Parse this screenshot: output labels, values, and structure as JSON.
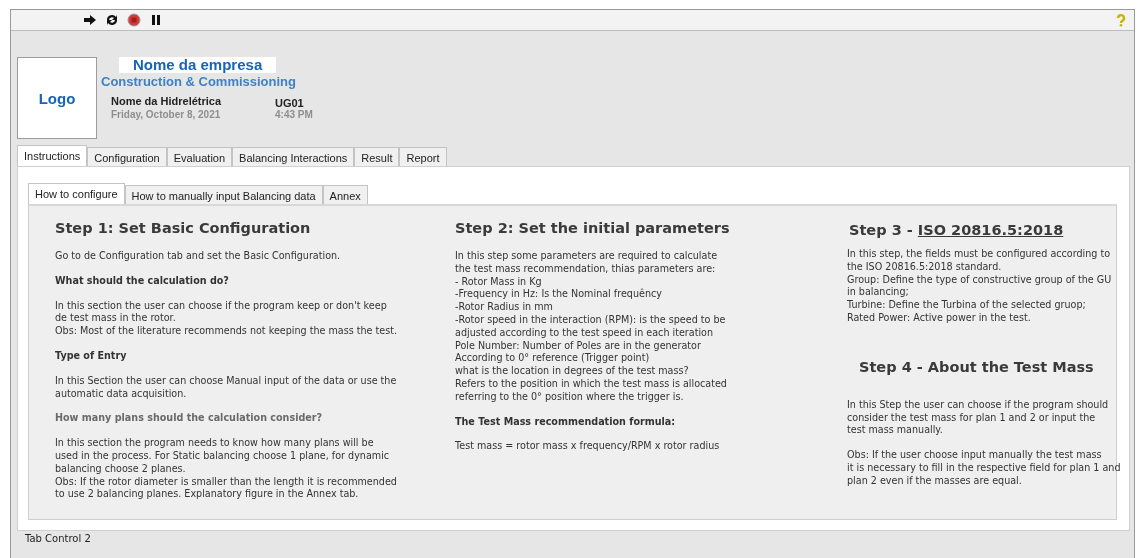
{
  "header": {
    "logo": "Logo",
    "company": "Nome da empresa",
    "subtitle": "Construction & Commissioning",
    "plant": "Nome da Hidrelétrica",
    "unit": "UG01",
    "date": "Friday, October 8, 2021",
    "time": "4:43 PM"
  },
  "tabs": [
    {
      "label": "Instructions",
      "selected": true
    },
    {
      "label": "Configuration",
      "selected": false
    },
    {
      "label": "Evaluation",
      "selected": false
    },
    {
      "label": "Balancing Interactions",
      "selected": false
    },
    {
      "label": "Result",
      "selected": false
    },
    {
      "label": "Report",
      "selected": false
    }
  ],
  "subtabs": [
    {
      "label": "How to configure",
      "selected": true
    },
    {
      "label": "How to manually input Balancing data",
      "selected": false
    },
    {
      "label": "Annex",
      "selected": false
    }
  ],
  "columns": [
    {
      "blocks": [
        {
          "kind": "heading",
          "text": "Step 1: Set Basic Configuration"
        },
        {
          "kind": "text",
          "lines": [
            "Go to de Configuration tab and set the Basic Configuration."
          ]
        },
        {
          "kind": "subheading",
          "lines": [
            "What should the calculation do?"
          ]
        },
        {
          "kind": "text",
          "lines": [
            "In this section the user can choose if the program keep or don't keep",
            "de test mass in the rotor.",
            "Obs: Most of the literature recommends not keeping the mass the test."
          ]
        },
        {
          "kind": "subheading",
          "lines": [
            "Type of Entry"
          ]
        },
        {
          "kind": "text",
          "lines": [
            "In this Section the user can choose Manual input of the data or use the",
            "automatic data acquisition."
          ]
        },
        {
          "kind": "mutedheading",
          "lines": [
            "How many plans should the calculation consider?"
          ]
        },
        {
          "kind": "text",
          "lines": [
            "In this section the program needs to know how many plans will be",
            "used in the process. For Static balancing choose 1 plane, for dynamic",
            "balancing choose 2 planes.",
            "Obs: If the rotor diameter is smaller than the length it is recommended",
            "to use 2 balancing planes. Explanatory figure in the Annex tab."
          ]
        }
      ]
    },
    {
      "blocks": [
        {
          "kind": "heading",
          "text": "Step 2: Set the initial parameters"
        },
        {
          "kind": "text",
          "lines": [
            "In this step some parameters are required to calculate",
            "the test mass recommendation, thias parameters are:",
            "- Rotor Mass in Kg",
            "-Frequency in Hz: Is the Nominal frequêncy",
            "-Rotor Radius in mm",
            "-Rotor speed in the interaction (RPM): is the speed to be",
            "adjusted according to the test speed in each iteration",
            "Pole Number: Number of Poles are in the generator",
            "According to 0° reference (Trigger point)",
            "what is the location in degrees of the test mass?",
            "Refers to the position in which the test mass is allocated",
            "referring to the 0° position where the trigger is."
          ]
        },
        {
          "kind": "subheading",
          "lines": [
            "The Test Mass recommendation formula:"
          ]
        },
        {
          "kind": "text",
          "lines": [
            "Test mass = rotor mass x frequency/RPM x rotor radius"
          ]
        }
      ]
    },
    {
      "blocks": [
        {
          "kind": "linkheading",
          "text": "Step 3 - ",
          "link": "ISO 20816.5:2018"
        },
        {
          "kind": "text",
          "lines": [
            "In this step, the fields must be configured according to",
            "the ISO 20816.5:2018 standard.",
            "Group: Define the type of constructive group of the GU",
            "in balancing;",
            "Turbine: Define the Turbina of the selected gruop;",
            "Rated Power: Active power in the test."
          ]
        },
        {
          "kind": "heading",
          "text": "Step 4 - About the Test Mass"
        },
        {
          "kind": "text",
          "lines": [
            "In this Step the user can choose if the program should",
            "consider the test mass for plan 1 and 2 or input the",
            "test mass manually."
          ]
        },
        {
          "kind": "text",
          "lines": [
            "Obs: If the user choose input manually the test mass",
            "it is necessary to fill in the respective field for plan 1 and",
            "plan 2 even if the masses are equal."
          ]
        }
      ]
    }
  ],
  "footer": "Tab Control 2"
}
